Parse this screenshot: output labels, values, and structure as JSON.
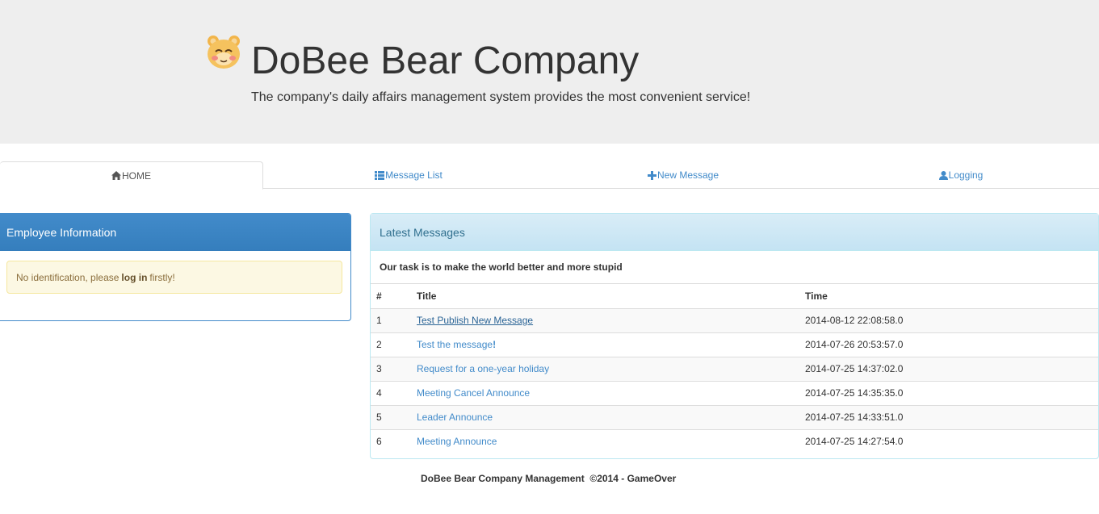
{
  "header": {
    "title": "DoBee Bear Company",
    "subtitle": "The company's daily affairs management system provides the most convenient service!"
  },
  "nav": {
    "tabs": [
      {
        "label": "HOME",
        "icon": "home-icon",
        "active": true
      },
      {
        "label": "Message List",
        "icon": "list-icon",
        "active": false
      },
      {
        "label": "New Message",
        "icon": "plus-icon",
        "active": false
      },
      {
        "label": "Logging",
        "icon": "user-icon",
        "active": false
      }
    ]
  },
  "employee_panel": {
    "heading": "Employee Information",
    "alert_prefix": "No identification, please",
    "alert_link": "log in",
    "alert_suffix": "firstly!"
  },
  "messages_panel": {
    "heading": "Latest Messages",
    "intro": "Our task is to make the world better and more stupid",
    "columns": [
      "#",
      "Title",
      "Time"
    ],
    "rows": [
      {
        "num": "1",
        "title": "Test Publish New Message",
        "time": "2014-08-12 22:08:58.0"
      },
      {
        "num": "2",
        "title": "Test the message",
        "title_suffix": "!",
        "time": "2014-07-26 20:53:57.0"
      },
      {
        "num": "3",
        "title": "Request for a one-year holiday",
        "time": "2014-07-25 14:37:02.0"
      },
      {
        "num": "4",
        "title": "Meeting Cancel Announce",
        "time": "2014-07-25 14:35:35.0"
      },
      {
        "num": "5",
        "title": "Leader Announce",
        "time": "2014-07-25 14:33:51.0"
      },
      {
        "num": "6",
        "title": "Meeting Announce",
        "time": "2014-07-25 14:27:54.0"
      }
    ]
  },
  "footer": {
    "text": "DoBee Bear Company Management  ©2014 - GameOver"
  },
  "colors": {
    "primary": "#428bca",
    "jumbotron_bg": "#eeeeee",
    "info_heading_bg": "#d9edf7",
    "warning_bg": "#fcf8e3"
  }
}
